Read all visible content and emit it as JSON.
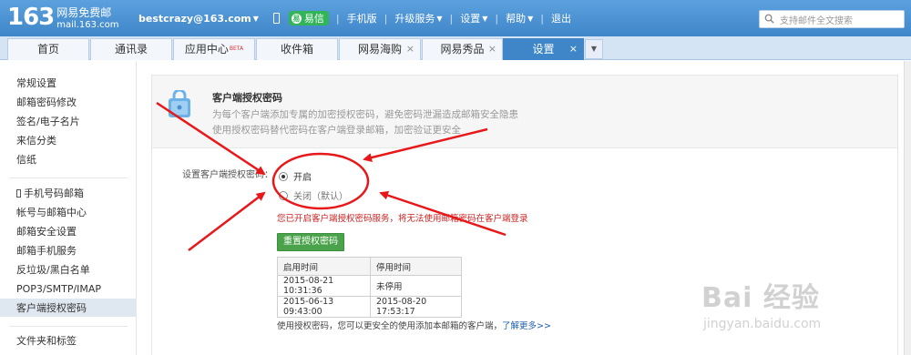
{
  "header": {
    "logo_num": "163",
    "logo_line1": "网易免费邮",
    "logo_line2": "mail.163.com",
    "user_email": "bestcrazy@163.com",
    "yixin_label": "易信",
    "links": [
      "手机版",
      "升级服务",
      "设置",
      "帮助",
      "退出"
    ],
    "search_placeholder": "支持邮件全文搜索"
  },
  "tabs": [
    {
      "label": "首页"
    },
    {
      "label": "通讯录"
    },
    {
      "label": "应用中心",
      "badge": "BETA"
    },
    {
      "label": "收件箱"
    },
    {
      "label": "网易海购",
      "close": "×"
    },
    {
      "label": "网易秀品",
      "close": "×"
    },
    {
      "label": "设置",
      "close": "×"
    }
  ],
  "sidebar": {
    "group1": [
      "常规设置",
      "邮箱密码修改",
      "签名/电子名片",
      "来信分类",
      "信纸"
    ],
    "group2": [
      "手机号码邮箱",
      "帐号与邮箱中心",
      "邮箱安全设置",
      "邮箱手机服务",
      "反垃圾/黑白名单",
      "POP3/SMTP/IMAP",
      "客户端授权密码"
    ],
    "group3": [
      "文件夹和标签"
    ]
  },
  "panel": {
    "title": "客户端授权密码",
    "desc1": "为每个客户端添加专属的加密授权密码，避免密码泄漏造成邮箱安全隐患",
    "desc2": "使用授权密码替代密码在客户端登录邮箱，加密验证更安全",
    "field_label": "设置客户端授权密码：",
    "radio_on": "开启",
    "radio_off": "关闭（默认）",
    "notice": "您已开启客户端授权密码服务，将无法使用邮箱密码在客户端登录",
    "reset_button": "重置授权密码",
    "table": {
      "headers": [
        "启用时间",
        "停用时间"
      ],
      "rows": [
        [
          "2015-08-21 10:31:36",
          "未停用"
        ],
        [
          "2015-06-13 09:43:00",
          "2015-08-20 17:53:17"
        ]
      ]
    },
    "footer_text": "使用授权密码，您可以更安全的使用添加本邮箱的客户端，",
    "footer_link": "了解更多>>"
  },
  "watermark": {
    "brand": "Bai 经验",
    "sub": "jingyan.baidu.com"
  },
  "colors": {
    "header_blue": "#3f86c9",
    "annotation_red": "#e8181a",
    "button_green": "#4aa34a"
  }
}
